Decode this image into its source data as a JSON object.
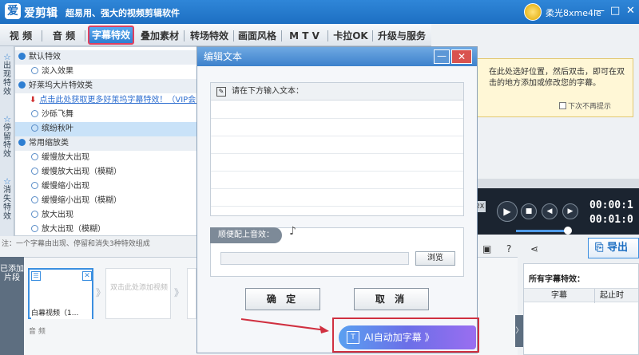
{
  "app": {
    "logo": "爱",
    "name": "爱剪辑",
    "slogan": "超易用、强大的视频剪辑软件",
    "user": "柔光8xme4le",
    "window_controls": [
      "—",
      "□",
      "✕"
    ]
  },
  "menu": {
    "tabs": [
      {
        "label": "视 频",
        "active": false
      },
      {
        "label": "音 频",
        "active": false
      },
      {
        "label": "字幕特效",
        "active": true
      },
      {
        "label": "叠加素材",
        "active": false
      },
      {
        "label": "转场特效",
        "active": false
      },
      {
        "label": "画面风格",
        "active": false
      },
      {
        "label": "M T V",
        "active": false
      },
      {
        "label": "卡拉OK",
        "active": false
      },
      {
        "label": "升级与服务",
        "active": false
      }
    ]
  },
  "vtabs": [
    {
      "icon": "☆",
      "label": "出现特效"
    },
    {
      "icon": "☆",
      "label": "停留特效"
    },
    {
      "icon": "☆",
      "label": "消失特效"
    }
  ],
  "tree": {
    "rows": [
      {
        "text": "默认特效",
        "kind": "cat"
      },
      {
        "text": "淡入效果",
        "kind": "item"
      },
      {
        "text": "好莱坞大片特效类",
        "kind": "cat"
      },
      {
        "text": "点击此处获取更多好莱坞字幕特效！（VIP会员专享）",
        "kind": "link"
      },
      {
        "text": "沙砾飞舞",
        "kind": "item"
      },
      {
        "text": "缤纷秋叶",
        "kind": "sel"
      },
      {
        "text": "常用缩放类",
        "kind": "cat"
      },
      {
        "text": "缓慢放大出现",
        "kind": "item"
      },
      {
        "text": "缓慢放大出现（模糊）",
        "kind": "item"
      },
      {
        "text": "缓慢缩小出现",
        "kind": "item"
      },
      {
        "text": "缓慢缩小出现（模糊）",
        "kind": "item"
      },
      {
        "text": "放大出现",
        "kind": "item"
      },
      {
        "text": "放大出现（模糊）",
        "kind": "item"
      }
    ],
    "note": "注：一个字幕由出现、停留和消失3种特效组成"
  },
  "timeline": {
    "side_label": "已添加片段",
    "clip1_caption": "白幕视频（1...",
    "clip2_text": "双击此处添加视频",
    "audio_label": "音 频"
  },
  "dialog": {
    "title": "编辑文本",
    "min": "—",
    "close": "✕",
    "input_hint": "请在下方输入文本：",
    "sound_label": "顺便配上音效：",
    "browse": "浏览",
    "ok": "确 定",
    "cancel": "取 消"
  },
  "ai": {
    "label": "AI自动加字幕 》"
  },
  "tooltip": {
    "text": "在此处选好位置，然后双击，即可在双击的地方添加或修改您的字幕。",
    "checkbox": "下次不再提示"
  },
  "player": {
    "speed": "2X",
    "time1": "00:00:1",
    "time2": "00:01:0"
  },
  "export": {
    "label": "导出"
  },
  "subtitles_panel": {
    "title": "所有字幕特效：",
    "col1": "字幕",
    "col2": "起止时"
  },
  "scroll_handle": "〉"
}
